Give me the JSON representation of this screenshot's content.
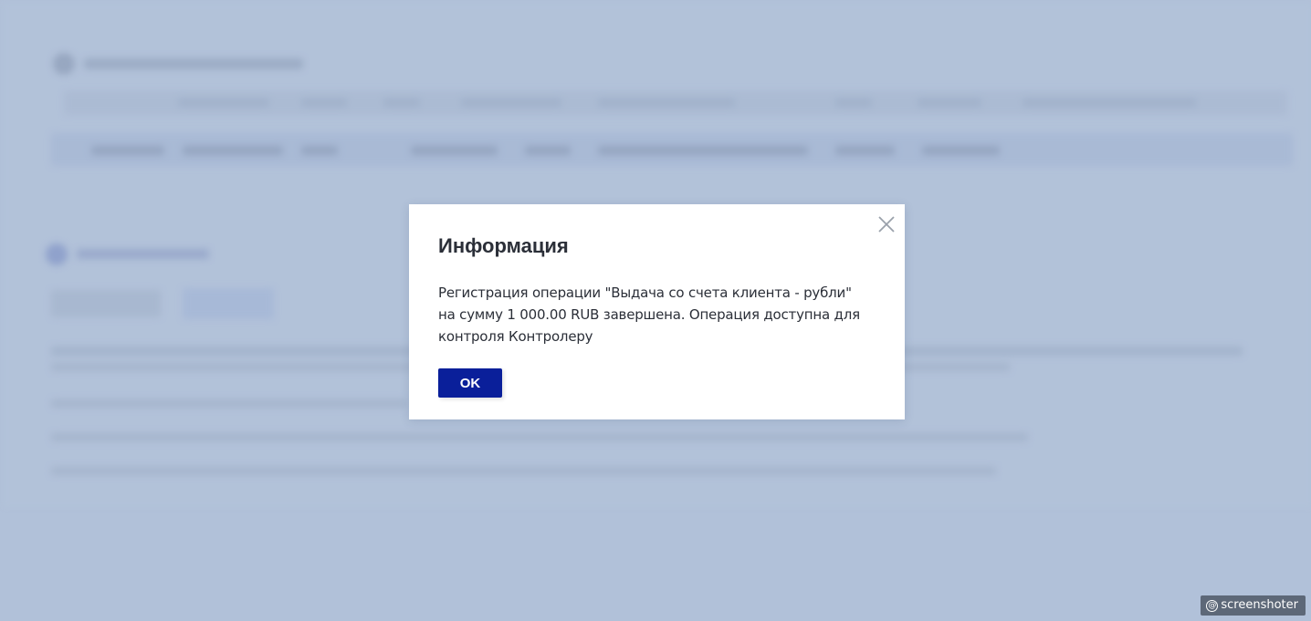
{
  "dialog": {
    "title": "Информация",
    "message": "Регистрация операции \"Выдача со счета клиента - рубли\" на сумму 1 000.00 RUB завершена. Операция доступна для контроля Контролеру",
    "ok_label": "OK",
    "close_icon": "close-icon"
  },
  "watermark": {
    "text": "screenshoter",
    "icon": "at-sign-icon"
  },
  "colors": {
    "backdrop": "#b0c0d8",
    "primary_button": "#0a1f9a",
    "dialog_bg": "#ffffff",
    "text": "#2b2f38"
  }
}
